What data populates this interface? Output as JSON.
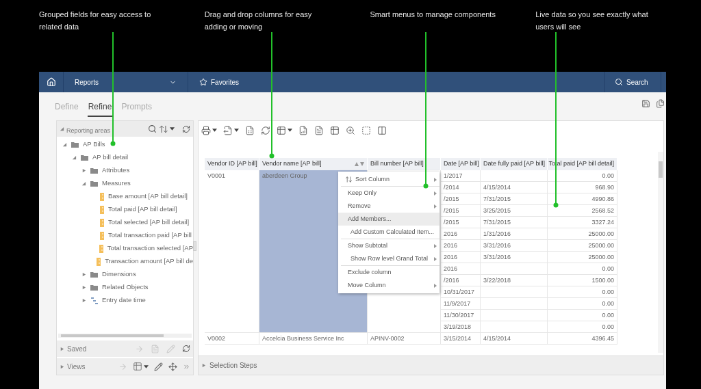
{
  "callouts": [
    {
      "text": "Grouped fields for easy access to related data"
    },
    {
      "text": "Drag and drop columns for easy adding or moving"
    },
    {
      "text": "Smart menus to manage components"
    },
    {
      "text": "Live data so you see exactly what users will see"
    }
  ],
  "top_bar": {
    "reports": "Reports",
    "favorites": "Favorites",
    "search": "Search"
  },
  "tabs": [
    {
      "label": "Define",
      "selected": false
    },
    {
      "label": "Refine",
      "selected": true
    },
    {
      "label": "Prompts",
      "selected": false
    }
  ],
  "left_panel": {
    "title": "Reporting areas",
    "tree": [
      {
        "label": "AP Bills",
        "kind": "folder",
        "expanded": true,
        "children": [
          {
            "label": "AP bill detail",
            "kind": "folder",
            "expanded": true,
            "children": [
              {
                "label": "Attributes",
                "kind": "folder",
                "expanded": false
              },
              {
                "label": "Measures",
                "kind": "folder",
                "expanded": true,
                "children": [
                  {
                    "label": "Base amount [AP bill detail]",
                    "kind": "measure"
                  },
                  {
                    "label": "Total paid [AP bill detail]",
                    "kind": "measure"
                  },
                  {
                    "label": "Total selected [AP bill detail]",
                    "kind": "measure"
                  },
                  {
                    "label": "Total transaction paid [AP bill",
                    "kind": "measure"
                  },
                  {
                    "label": "Total transaction selected [AP",
                    "kind": "measure"
                  },
                  {
                    "label": "Transaction amount [AP bill de",
                    "kind": "measure"
                  }
                ]
              },
              {
                "label": "Dimensions",
                "kind": "folder",
                "expanded": false
              },
              {
                "label": "Related Objects",
                "kind": "folder",
                "expanded": false
              },
              {
                "label": "Entry date time",
                "kind": "hierarchy",
                "expanded": false
              }
            ]
          }
        ]
      }
    ],
    "sections": [
      {
        "label": "Saved",
        "expanded": false
      },
      {
        "label": "Views",
        "expanded": false
      }
    ]
  },
  "table": {
    "columns": [
      "Vendor ID [AP bill]",
      "Vendor name [AP bill]",
      "Bill number [AP bill]",
      "Date [AP bill]",
      "Date fully paid [AP bill]",
      "Total paid [AP bill detail]"
    ],
    "groups": [
      {
        "vendor_id": "V0001",
        "vendor_name": "aberdeen Group",
        "selected": true,
        "rows": [
          {
            "date": "1/2017",
            "total_paid": "0.00"
          },
          {
            "date": "/2014",
            "date_fully_paid": "4/15/2014",
            "total_paid": "968.90"
          },
          {
            "date": "/2015",
            "date_fully_paid": "7/31/2015",
            "total_paid": "4990.86"
          },
          {
            "date": "/2015",
            "date_fully_paid": "3/25/2015",
            "total_paid": "2568.52"
          },
          {
            "date": "/2015",
            "date_fully_paid": "7/31/2015",
            "total_paid": "3327.24"
          },
          {
            "date": "2016",
            "date_fully_paid": "1/31/2016",
            "total_paid": "25000.00"
          },
          {
            "date": "2016",
            "date_fully_paid": "3/31/2016",
            "total_paid": "25000.00"
          },
          {
            "date": "2016",
            "date_fully_paid": "3/31/2016",
            "total_paid": "25000.00"
          },
          {
            "date": "2016",
            "total_paid": "0.00"
          },
          {
            "date": "/2016",
            "date_fully_paid": "3/22/2018",
            "total_paid": "1500.00"
          },
          {
            "date": "10/31/2017",
            "total_paid": "0.00"
          },
          {
            "date": "11/9/2017",
            "total_paid": "0.00"
          },
          {
            "date": "11/30/2017",
            "total_paid": "0.00"
          },
          {
            "date": "3/19/2018",
            "total_paid": "0.00"
          }
        ]
      },
      {
        "vendor_id": "V0002",
        "vendor_name": "Accelcia Business Service Inc",
        "bill_number": "APINV-0002",
        "selected": false,
        "rows": [
          {
            "date": "3/15/2014",
            "date_fully_paid": "4/15/2014",
            "total_paid": "4396.45"
          }
        ]
      }
    ]
  },
  "context_menu": [
    {
      "label": "Sort Column",
      "submenu": true,
      "selected": false,
      "separator_after": true,
      "kind": "sort"
    },
    {
      "label": "Keep Only",
      "submenu": true,
      "selected": false,
      "separator_after": false
    },
    {
      "label": "Remove",
      "submenu": true,
      "selected": false,
      "separator_after": false
    },
    {
      "label": "Add Members...",
      "submenu": false,
      "selected": true,
      "separator_after": false
    },
    {
      "label": "Add Custom Calculated Item...",
      "submenu": false,
      "selected": false,
      "separator_after": true
    },
    {
      "label": "Show Subtotal",
      "submenu": true,
      "selected": false,
      "separator_after": false
    },
    {
      "label": "Show Row level Grand Total",
      "submenu": true,
      "selected": false,
      "separator_after": true
    },
    {
      "label": "Exclude column",
      "submenu": false,
      "selected": false,
      "separator_after": false
    },
    {
      "label": "Move Column",
      "submenu": true,
      "selected": false,
      "separator_after": false
    }
  ],
  "selection_steps": {
    "label": "Selection Steps",
    "expanded": false
  }
}
